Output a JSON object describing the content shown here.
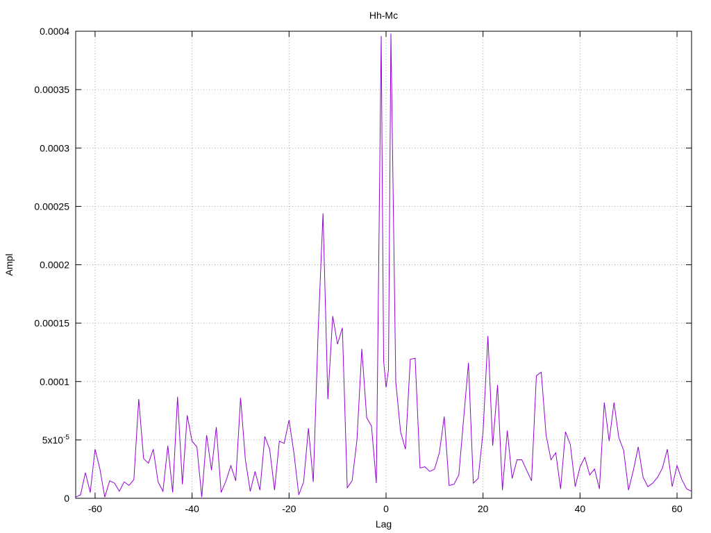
{
  "chart_data": {
    "type": "line",
    "title": "Hh-Mc",
    "xlabel": "Lag",
    "ylabel": "Ampl",
    "xlim": [
      -64,
      63
    ],
    "ylim": [
      0,
      0.0004
    ],
    "grid": true,
    "x_ticks": [
      -60,
      -40,
      -20,
      0,
      20,
      40,
      60
    ],
    "x_tick_labels": [
      "-60",
      "-40",
      "-20",
      "0",
      "20",
      "40",
      "60"
    ],
    "y_ticks": [
      0,
      5e-05,
      0.0001,
      0.00015,
      0.0002,
      0.00025,
      0.0003,
      0.00035,
      0.0004
    ],
    "y_tick_labels": [
      "0",
      "5x10-5",
      "0.0001",
      "0.00015",
      "0.0002",
      "0.00025",
      "0.0003",
      "0.00035",
      "0.0004"
    ],
    "series_color": "#9400d3",
    "series": [
      {
        "x": [
          -64,
          -63,
          -62,
          -61,
          -60,
          -59,
          -58,
          -57,
          -56,
          -55,
          -54,
          -53,
          -52,
          -51,
          -50,
          -49,
          -48,
          -47,
          -46,
          -45,
          -44,
          -43,
          -42,
          -41,
          -40,
          -39,
          -38,
          -37,
          -36,
          -35,
          -34,
          -33,
          -32,
          -31,
          -30,
          -29,
          -28,
          -27,
          -26,
          -25,
          -24,
          -23,
          -22,
          -21,
          -20,
          -19,
          -18,
          -17,
          -16,
          -15,
          -14,
          -13,
          -12,
          -11,
          -10,
          -9,
          -8,
          -7,
          -6,
          -5,
          -4,
          -3,
          -2,
          -1,
          -0.5,
          0,
          0.5,
          1,
          2,
          3,
          4,
          5,
          6,
          7,
          8,
          9,
          10,
          11,
          12,
          13,
          14,
          15,
          16,
          17,
          18,
          19,
          20,
          21,
          22,
          23,
          24,
          25,
          26,
          27,
          28,
          29,
          30,
          31,
          32,
          33,
          34,
          35,
          36,
          37,
          38,
          39,
          40,
          41,
          42,
          43,
          44,
          45,
          46,
          47,
          48,
          49,
          50,
          51,
          52,
          53,
          54,
          55,
          56,
          57,
          58,
          59,
          60,
          61,
          62,
          63
        ],
        "y": [
          1e-06,
          3e-06,
          2.2e-05,
          5e-06,
          4.2e-05,
          2.5e-05,
          1e-06,
          1.5e-05,
          1.3e-05,
          6e-06,
          1.4e-05,
          1.1e-05,
          1.6e-05,
          8.5e-05,
          3.4e-05,
          3e-05,
          4.2e-05,
          1.4e-05,
          6e-06,
          4.5e-05,
          5e-06,
          8.7e-05,
          1.2e-05,
          7.1e-05,
          4.9e-05,
          4.4e-05,
          1e-06,
          5.4e-05,
          2.4e-05,
          6.1e-05,
          5e-06,
          1.5e-05,
          2.8e-05,
          1.5e-05,
          8.6e-05,
          3.3e-05,
          6e-06,
          2.3e-05,
          7e-06,
          5.3e-05,
          4.2e-05,
          7e-06,
          4.9e-05,
          4.7e-05,
          6.7e-05,
          3.9e-05,
          3e-06,
          1.4e-05,
          6e-05,
          1.4e-05,
          0.000143,
          0.000244,
          8.5e-05,
          0.000156,
          0.000132,
          0.000146,
          9e-06,
          1.5e-05,
          5e-05,
          0.000128,
          6.9e-05,
          6.2e-05,
          1.3e-05,
          0.000396,
          0.000118,
          9.5e-05,
          0.00011,
          0.000398,
          0.0001,
          5.7e-05,
          4.2e-05,
          0.000119,
          0.00012,
          2.6e-05,
          2.7e-05,
          2.3e-05,
          2.5e-05,
          3.9e-05,
          7e-05,
          1.1e-05,
          1.2e-05,
          2e-05,
          6.8e-05,
          0.000116,
          1.3e-05,
          1.7e-05,
          5.7e-05,
          0.000139,
          4.5e-05,
          9.7e-05,
          7e-06,
          5.8e-05,
          1.7e-05,
          3.3e-05,
          3.3e-05,
          2.4e-05,
          1.5e-05,
          0.000105,
          0.000108,
          5.4e-05,
          3.3e-05,
          3.9e-05,
          8e-06,
          5.7e-05,
          4.6e-05,
          1e-05,
          2.7e-05,
          3.5e-05,
          2e-05,
          2.5e-05,
          8e-06,
          8.2e-05,
          4.9e-05,
          8.2e-05,
          5.2e-05,
          4.1e-05,
          7e-06,
          2.4e-05,
          4.4e-05,
          1.8e-05,
          1e-05,
          1.3e-05,
          1.8e-05,
          2.6e-05,
          4.2e-05,
          1e-05,
          2.8e-05,
          1.6e-05,
          8e-06,
          6e-06
        ]
      }
    ]
  }
}
